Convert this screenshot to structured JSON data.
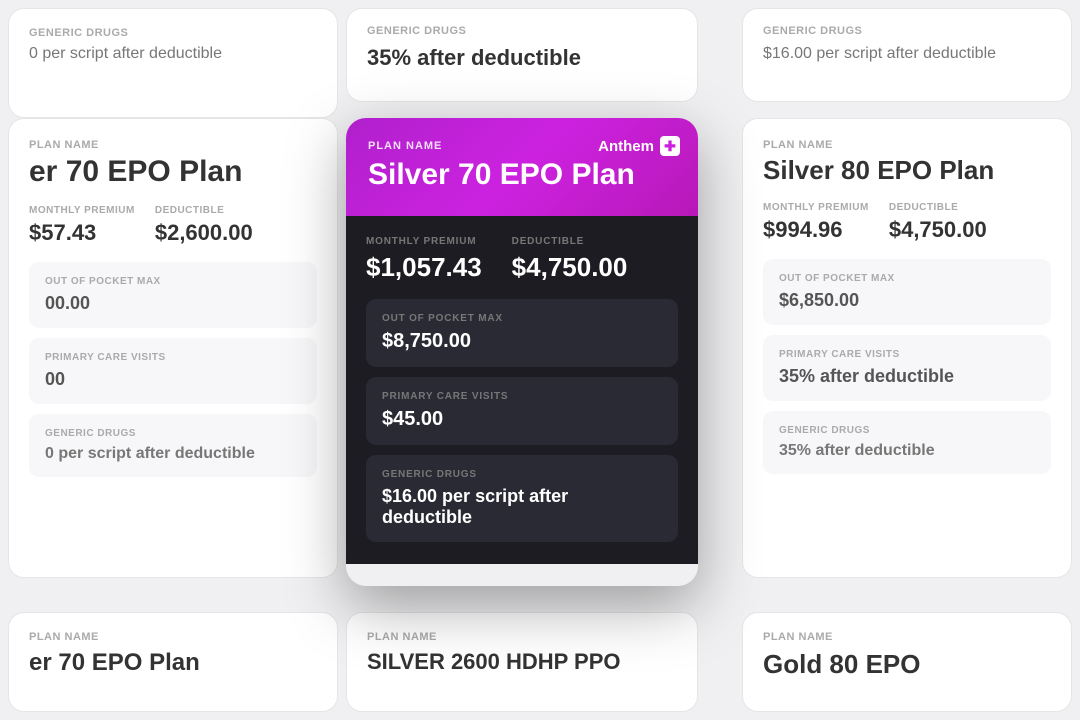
{
  "page": {
    "background": "#f0f0f2"
  },
  "top_center_card": {
    "plan_label": "GENERIC DRUGS",
    "value": "35% after deductible"
  },
  "left_cards": {
    "card1": {
      "label": "GENERIC DRUGS",
      "value": "0 per script after deductible"
    },
    "card2": {
      "plan_label": "PLAN NAME",
      "plan_name": "er 70 EPO Plan",
      "monthly_premium_label": "MONTHLY PREMIUM",
      "monthly_premium": "$57.43",
      "deductible_label": "DEDUCTIBLE",
      "deductible": "$2,600.00",
      "oop_label": "OUT OF POCKET MAX",
      "oop": "00.00",
      "pcv_label": "PRIMARY CARE VISITS",
      "pcv": "00",
      "generic_label": "GENERIC DRUGS",
      "generic": "0 per script after deductible"
    }
  },
  "right_cards": {
    "card1": {
      "label": "GENERIC DRUGS",
      "value": "$16.00 per script after deductible"
    },
    "card2": {
      "plan_label": "PLAN NAME",
      "plan_name": "Silver 80 EPO Plan",
      "monthly_premium_label": "MONTHLY PREMIUM",
      "monthly_premium": "$994.96",
      "deductible_label": "DEDUCTIBLE",
      "deductible": "$4,750.00",
      "oop_label": "OUT OF POCKET MAX",
      "oop": "$6,850.00",
      "pcv_label": "PRIMARY CARE VISITS",
      "pcv": "35% after deductible",
      "generic_label": "GENERIC DRUGS",
      "generic": "35% after deductible"
    }
  },
  "bottom_cards": {
    "left": {
      "plan_label": "PLAN NAME",
      "plan_name": "er 70 EPO Plan"
    },
    "center": {
      "plan_label": "PLAN NAME",
      "plan_name": "SILVER 2600 HDHP PPO"
    },
    "right": {
      "plan_label": "PLAN NAME",
      "plan_name": "Gold 80 EPO"
    }
  },
  "featured": {
    "anthem_label": "Anthem",
    "plan_label": "PLAN NAME",
    "plan_name": "Silver 70 EPO Plan",
    "monthly_premium_label": "MONTHLY PREMIUM",
    "monthly_premium": "$1,057.43",
    "deductible_label": "DEDUCTIBLE",
    "deductible": "$4,750.00",
    "oop_label": "OUT OF POCKET MAX",
    "oop_value": "$8,750.00",
    "pcv_label": "PRIMARY CARE VISITS",
    "pcv_value": "$45.00",
    "generic_label": "GENERIC DRUGS",
    "generic_value": "$16.00 per script after deductible"
  }
}
